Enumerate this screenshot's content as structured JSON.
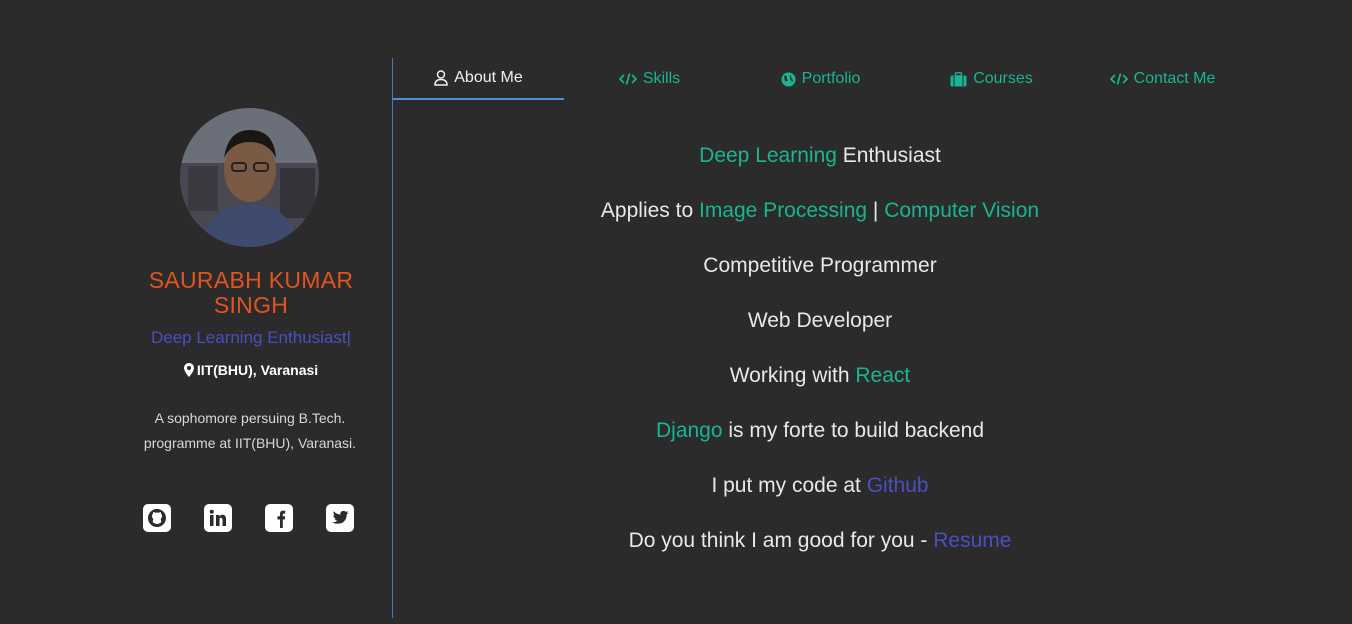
{
  "profile": {
    "name": "SAURABH KUMAR SINGH",
    "tagline": "Deep Learning Enthusiast|",
    "location": "IIT(BHU), Varanasi",
    "bio": "A sophomore persuing B.Tech. programme at IIT(BHU), Varanasi."
  },
  "socials": [
    {
      "name": "github",
      "icon": "github-icon"
    },
    {
      "name": "linkedin",
      "icon": "linkedin-icon"
    },
    {
      "name": "facebook",
      "icon": "facebook-icon"
    },
    {
      "name": "twitter",
      "icon": "twitter-icon"
    }
  ],
  "tabs": [
    {
      "label": "About Me",
      "icon": "user-icon",
      "active": true
    },
    {
      "label": "Skills",
      "icon": "code-icon"
    },
    {
      "label": "Portfolio",
      "icon": "globe-icon"
    },
    {
      "label": "Courses",
      "icon": "briefcase-icon"
    },
    {
      "label": "Contact Me",
      "icon": "code-icon"
    }
  ],
  "about": {
    "l1_link": "Deep Learning",
    "l1_text": " Enthusiast",
    "l2_text": "Applies to ",
    "l2_link1": "Image Processing",
    "l2_sep": " | ",
    "l2_link2": "Computer Vision",
    "l3_text": "Competitive Programmer",
    "l4_text": "Web Developer",
    "l5_text": "Working with ",
    "l5_link": "React",
    "l6_link": "Django",
    "l6_text": " is my forte to build backend",
    "l7_text": "I put my code at ",
    "l7_link": "Github",
    "l8_text": "Do you think I am good for you - ",
    "l8_link": "Resume"
  },
  "colors": {
    "background": "#2b2b2b",
    "accent_green": "#19b592",
    "accent_blue": "#4a4fbf",
    "name_orange": "#e2541f",
    "tab_underline": "#4a8fd9"
  }
}
